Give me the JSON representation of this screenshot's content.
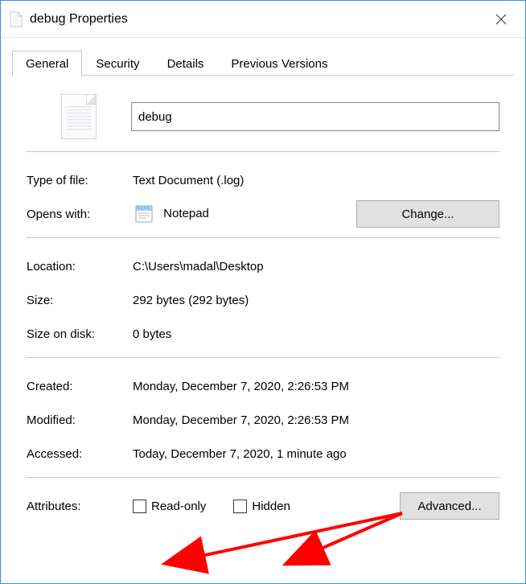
{
  "titlebar": {
    "title": "debug Properties"
  },
  "tabs": [
    {
      "label": "General",
      "active": true
    },
    {
      "label": "Security",
      "active": false
    },
    {
      "label": "Details",
      "active": false
    },
    {
      "label": "Previous Versions",
      "active": false
    }
  ],
  "filename": "debug",
  "fields": {
    "type_of_file": {
      "label": "Type of file:",
      "value": "Text Document (.log)"
    },
    "opens_with": {
      "label": "Opens with:",
      "app": "Notepad",
      "change_btn": "Change..."
    },
    "location": {
      "label": "Location:",
      "value": "C:\\Users\\madal\\Desktop"
    },
    "size": {
      "label": "Size:",
      "value": "292 bytes (292 bytes)"
    },
    "size_on_disk": {
      "label": "Size on disk:",
      "value": "0 bytes"
    },
    "created": {
      "label": "Created:",
      "value": "Monday, December 7, 2020, 2:26:53 PM"
    },
    "modified": {
      "label": "Modified:",
      "value": "Monday, December 7, 2020, 2:26:53 PM"
    },
    "accessed": {
      "label": "Accessed:",
      "value": "Today, December 7, 2020, 1 minute ago"
    }
  },
  "attributes": {
    "label": "Attributes:",
    "readonly_label": "Read-only",
    "hidden_label": "Hidden",
    "advanced_btn": "Advanced..."
  },
  "annotation": {
    "color": "#ff0000"
  }
}
